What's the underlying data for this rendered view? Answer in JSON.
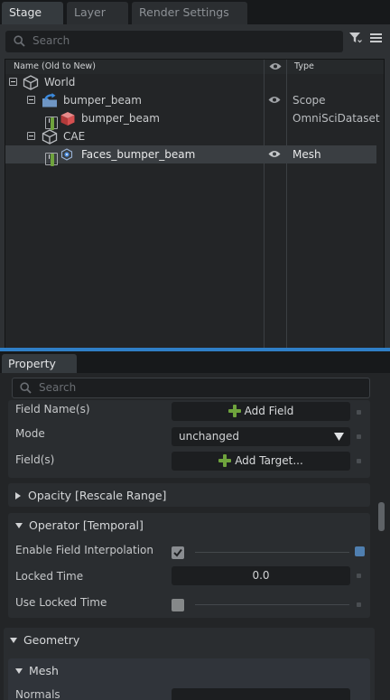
{
  "stage": {
    "tabs": [
      {
        "label": "Stage",
        "active": true
      },
      {
        "label": "Layer",
        "active": false
      },
      {
        "label": "Render Settings",
        "active": false
      }
    ],
    "search_placeholder": "Search",
    "columns": {
      "name": "Name (Old to New)",
      "type": "Type"
    },
    "tree": [
      {
        "label": "World",
        "type": "",
        "icon": "xform-cube-icon",
        "eye": false,
        "selected": false
      },
      {
        "label": "bumper_beam",
        "type": "Scope",
        "icon": "reference-folder-icon",
        "eye": true,
        "selected": false
      },
      {
        "label": "bumper_beam",
        "type": "OmniSciDataset",
        "icon": "red-cube-icon",
        "eye": false,
        "selected": false
      },
      {
        "label": "CAE",
        "type": "",
        "icon": "xform-cube-icon",
        "eye": false,
        "selected": false
      },
      {
        "label": "Faces_bumper_beam",
        "type": "Mesh",
        "icon": "mesh-icon",
        "eye": true,
        "selected": true
      }
    ]
  },
  "property": {
    "tab": "Property",
    "search_placeholder": "Search",
    "field_name_label": "Field Name(s)",
    "add_field_label": "Add Field",
    "mode_label": "Mode",
    "mode_value": "unchanged",
    "fields_label": "Field(s)",
    "add_target_label": "Add Target...",
    "opacity_section": "Opacity [Rescale Range]",
    "operator_section": "Operator [Temporal]",
    "enable_interp_label": "Enable Field Interpolation",
    "enable_interp_checked": true,
    "locked_time_label": "Locked Time",
    "locked_time_value": "0.0",
    "use_locked_time_label": "Use Locked Time",
    "use_locked_time_checked": false,
    "geometry_section": "Geometry",
    "mesh_section": "Mesh",
    "normals_label": "Normals"
  },
  "colors": {
    "accent": "#2f7fc7",
    "add_icon": "#6fa33d"
  }
}
